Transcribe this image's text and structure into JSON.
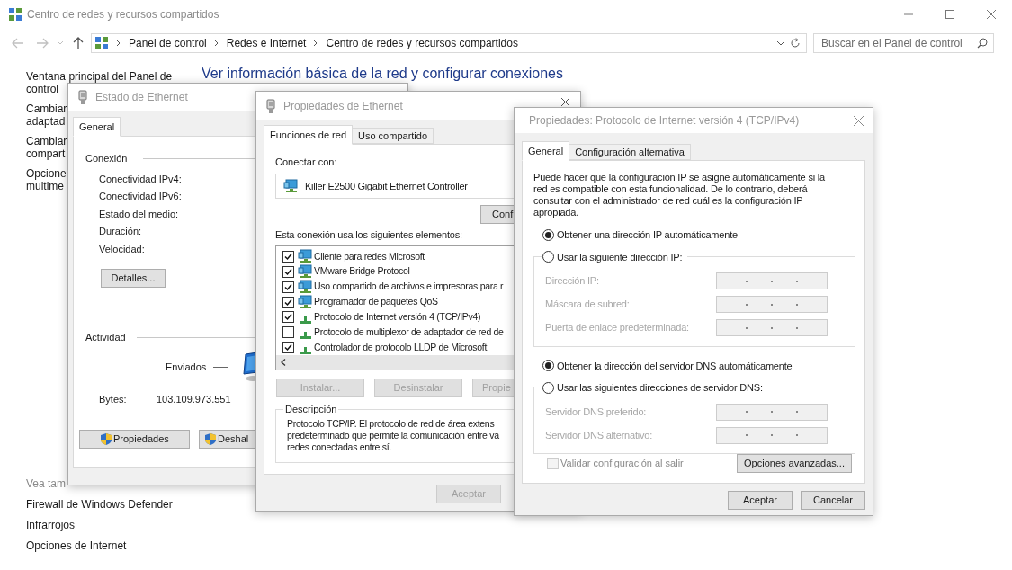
{
  "main_window": {
    "title": "Centro de redes y recursos compartidos",
    "breadcrumb": [
      "Panel de control",
      "Redes e Internet",
      "Centro de redes y recursos compartidos"
    ],
    "search": {
      "placeholder": "Buscar en el Panel de control"
    },
    "heading": "Ver información básica de la red y configurar conexiones",
    "sidebar_links": [
      {
        "lines": [
          "Ventana principal del Panel de",
          "control"
        ]
      },
      {
        "lines": [
          "Cambiar",
          "adaptad"
        ]
      },
      {
        "lines": [
          "Cambiar",
          "compart"
        ]
      },
      {
        "lines": [
          "Opcione",
          "multime"
        ]
      }
    ],
    "see_also": {
      "heading": "Vea tam",
      "links": [
        "Firewall de Windows Defender",
        "Infrarrojos",
        "Opciones de Internet"
      ]
    }
  },
  "ethernet_status": {
    "title": "Estado de Ethernet",
    "tabs": [
      {
        "label": "General",
        "selected": true
      }
    ],
    "connection": {
      "heading": "Conexión",
      "fields": [
        "Conectividad IPv4:",
        "Conectividad IPv6:",
        "Estado del medio:",
        "Duración:",
        "Velocidad:"
      ]
    },
    "details_button": "Detalles...",
    "activity": {
      "heading": "Actividad",
      "sent_label": "Enviados",
      "bytes_label": "Bytes:",
      "bytes_sent": "103.109.973.551"
    },
    "buttons": [
      "Propiedades",
      "Deshal"
    ]
  },
  "ethernet_properties": {
    "title": "Propiedades de Ethernet",
    "tabs": [
      {
        "label": "Funciones de red",
        "selected": true
      },
      {
        "label": "Uso compartido",
        "selected": false
      }
    ],
    "connect_label": "Conectar con:",
    "adapter": "Killer E2500 Gigabit Ethernet Controller",
    "configure_button": "Conf",
    "items_label": "Esta conexión usa los siguientes elementos:",
    "items": [
      {
        "label": "Cliente para redes Microsoft",
        "checked": true,
        "kind": "network"
      },
      {
        "label": "VMware Bridge Protocol",
        "checked": true,
        "kind": "network"
      },
      {
        "label": "Uso compartido de archivos e impresoras para r",
        "checked": true,
        "kind": "network"
      },
      {
        "label": "Programador de paquetes QoS",
        "checked": true,
        "kind": "network"
      },
      {
        "label": "Protocolo de Internet versión 4 (TCP/IPv4)",
        "checked": true,
        "kind": "protocol"
      },
      {
        "label": "Protocolo de multiplexor de adaptador de red de",
        "checked": false,
        "kind": "protocol"
      },
      {
        "label": "Controlador de protocolo LLDP de Microsoft",
        "checked": true,
        "kind": "protocol"
      }
    ],
    "item_buttons": [
      {
        "label": "Instalar...",
        "disabled": true
      },
      {
        "label": "Desinstalar",
        "disabled": true
      },
      {
        "label": "Propie",
        "disabled": true
      }
    ],
    "description": {
      "heading": "Descripción",
      "lines": [
        "Protocolo TCP/IP. El protocolo de red de área extens",
        "predeterminado que permite la comunicación entre va",
        "redes conectadas entre sí."
      ]
    },
    "buttons": [
      {
        "label": "Aceptar",
        "disabled": true
      }
    ]
  },
  "ipv4_properties": {
    "title": "Propiedades: Protocolo de Internet versión 4 (TCP/IPv4)",
    "tabs": [
      {
        "label": "General",
        "selected": true
      },
      {
        "label": "Configuración alternativa",
        "selected": false
      }
    ],
    "intro": "Puede hacer que la configuración IP se asigne automáticamente si la red es compatible con esta funcionalidad. De lo contrario, deberá consultar con el administrador de red cuál es la configuración IP apropiada.",
    "ip_options": [
      {
        "label": "Obtener una dirección IP automáticamente",
        "selected": true
      },
      {
        "label": "Usar la siguiente dirección IP:",
        "selected": false
      }
    ],
    "ip_fields": [
      {
        "label": "Dirección IP:",
        "disabled": true
      },
      {
        "label": "Máscara de subred:",
        "disabled": true
      },
      {
        "label": "Puerta de enlace predeterminada:",
        "disabled": true
      }
    ],
    "dns_options": [
      {
        "label": "Obtener la dirección del servidor DNS automáticamente",
        "selected": true
      },
      {
        "label": "Usar las siguientes direcciones de servidor DNS:",
        "selected": false
      }
    ],
    "dns_fields": [
      {
        "label": "Servidor DNS preferido:",
        "disabled": true
      },
      {
        "label": "Servidor DNS alternativo:",
        "disabled": true
      }
    ],
    "validate": {
      "label": "Validar configuración al salir",
      "checked": false,
      "disabled": true
    },
    "advanced_button": "Opciones avanzadas...",
    "buttons": [
      "Aceptar",
      "Cancelar"
    ]
  }
}
